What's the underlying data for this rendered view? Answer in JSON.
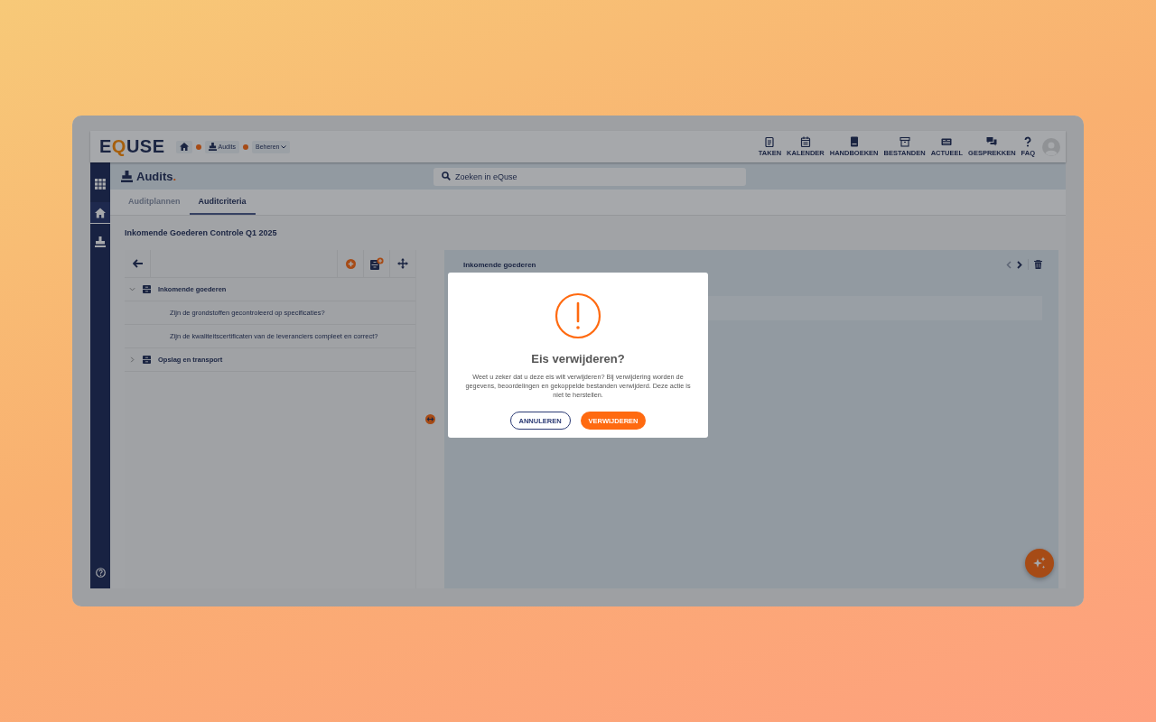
{
  "logo": {
    "text": "EQUSE"
  },
  "breadcrumb": [
    {
      "kind": "home"
    },
    {
      "kind": "link",
      "label": "Audits"
    },
    {
      "kind": "dropdown",
      "label": "Beheren"
    }
  ],
  "nav": [
    {
      "kind": "clipboard",
      "label": "TAKEN"
    },
    {
      "kind": "calendar",
      "label": "KALENDER"
    },
    {
      "kind": "book",
      "label": "HANDBOEKEN"
    },
    {
      "kind": "archive",
      "label": "BESTANDEN"
    },
    {
      "kind": "news",
      "label": "ACTUEEL"
    },
    {
      "kind": "chat",
      "label": "GESPREKKEN"
    },
    {
      "kind": "help",
      "label": "FAQ"
    }
  ],
  "sidebar": {
    "items": [
      {
        "kind": "grid",
        "selected": false
      },
      {
        "kind": "home",
        "selected": true
      },
      {
        "kind": "stamp",
        "selected": false
      }
    ]
  },
  "page": {
    "title": "Audits",
    "suffix": "."
  },
  "search": {
    "placeholder": "Zoeken in eQuse"
  },
  "tabs": [
    {
      "label": "Auditplannen",
      "selected": false
    },
    {
      "label": "Auditcriteria",
      "selected": true
    }
  ],
  "heading": "Inkomende Goederen Controle Q1 2025",
  "tree": [
    {
      "label": "Inkomende goederen",
      "expanded": true,
      "children": [
        {
          "label": "Zijn de grondstoffen gecontroleerd op specificaties?"
        },
        {
          "label": "Zijn de kwaliteitscertificaten van de leveranciers compleet en correct?"
        }
      ]
    },
    {
      "label": "Opslag en transport",
      "expanded": false
    }
  ],
  "detail": {
    "title": "Inkomende goederen"
  },
  "dialog": {
    "title": "Eis verwijderen?",
    "message": "Weet u zeker dat u deze eis wilt verwijderen? Bij verwijdering worden de gegevens, beoordelingen en gekoppelde bestanden verwijderd. Deze actie is niet te herstellen.",
    "buttons": [
      {
        "kind": "secondary",
        "label": "ANNULEREN"
      },
      {
        "kind": "primary",
        "label": "VERWIJDEREN"
      }
    ]
  }
}
